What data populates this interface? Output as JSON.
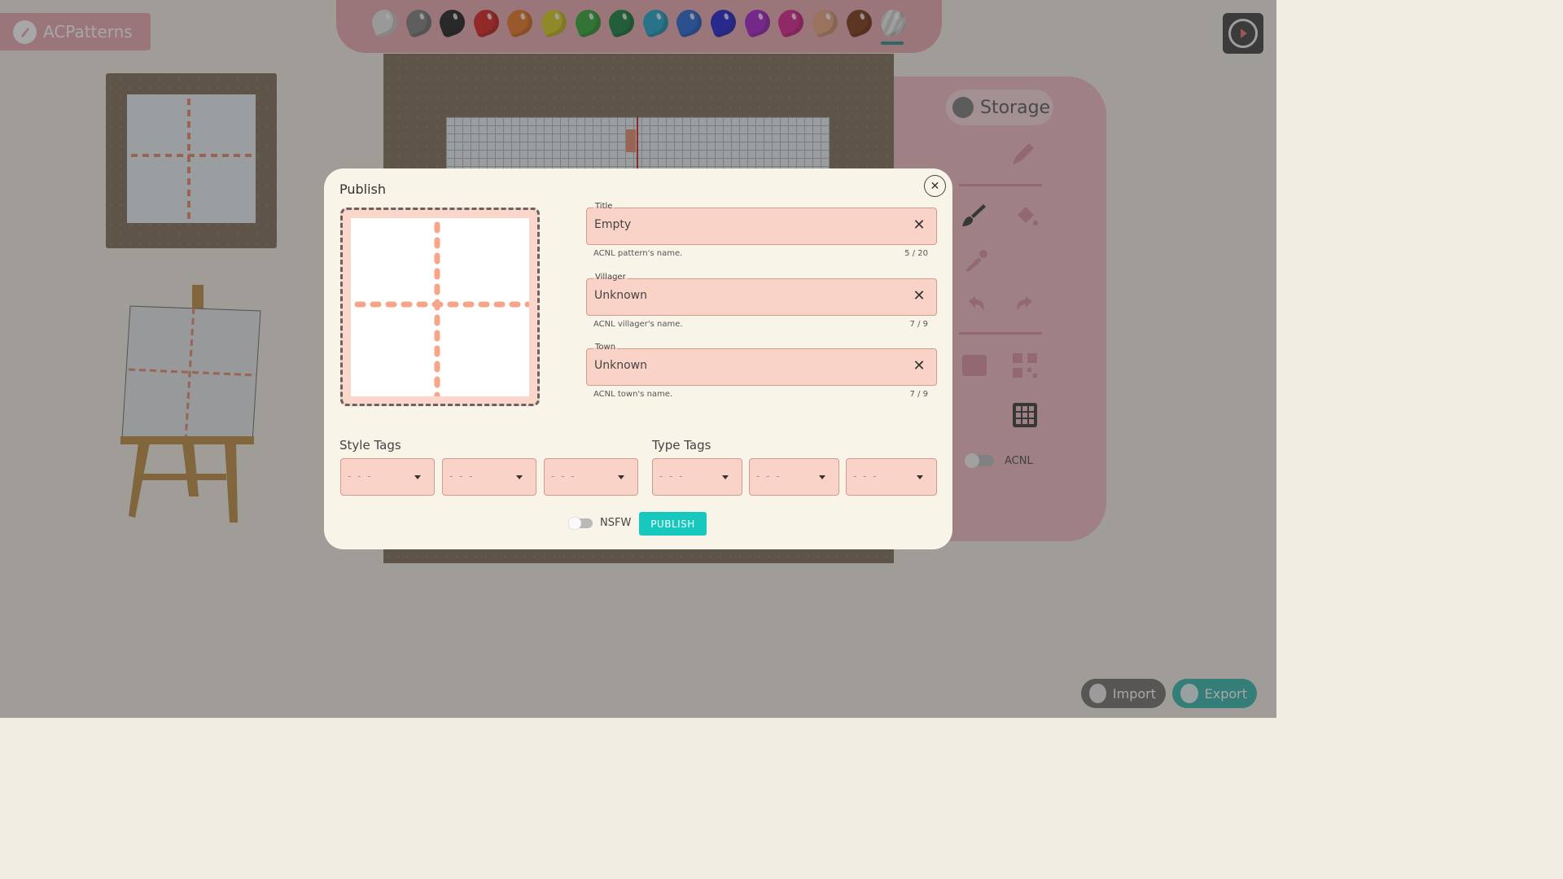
{
  "app": {
    "logo_text": "ACPatterns"
  },
  "palette": {
    "colors": [
      "#e6e6e6",
      "#7a7a7a",
      "#1a1a1a",
      "#d81b1b",
      "#e8721c",
      "#d6c81c",
      "#2ca02c",
      "#107a3a",
      "#1aa0c8",
      "#1f5fd0",
      "#1a1ad0",
      "#a21ac8",
      "#d81b8a",
      "#e6a07a",
      "#7a3010"
    ],
    "selected": "transparent"
  },
  "storage": {
    "label": "Storage"
  },
  "toggle": {
    "acnl_label": "ACNL"
  },
  "footer": {
    "import_label": "Import",
    "export_label": "Export"
  },
  "modal": {
    "title": "Publish",
    "fields": {
      "title": {
        "label": "Title",
        "value": "Empty",
        "helper": "ACNL pattern's name.",
        "count": "5 / 20"
      },
      "villager": {
        "label": "Villager",
        "value": "Unknown",
        "helper": "ACNL villager's name.",
        "count": "7 / 9"
      },
      "town": {
        "label": "Town",
        "value": "Unknown",
        "helper": "ACNL town's name.",
        "count": "7 / 9"
      }
    },
    "style_tags_label": "Style Tags",
    "type_tags_label": "Type Tags",
    "style_tags": [
      "- - -",
      "- - -",
      "- - -"
    ],
    "type_tags": [
      "- - -",
      "- - -",
      "- - -"
    ],
    "nsfw_label": "NSFW",
    "publish_label": "PUBLISH"
  }
}
